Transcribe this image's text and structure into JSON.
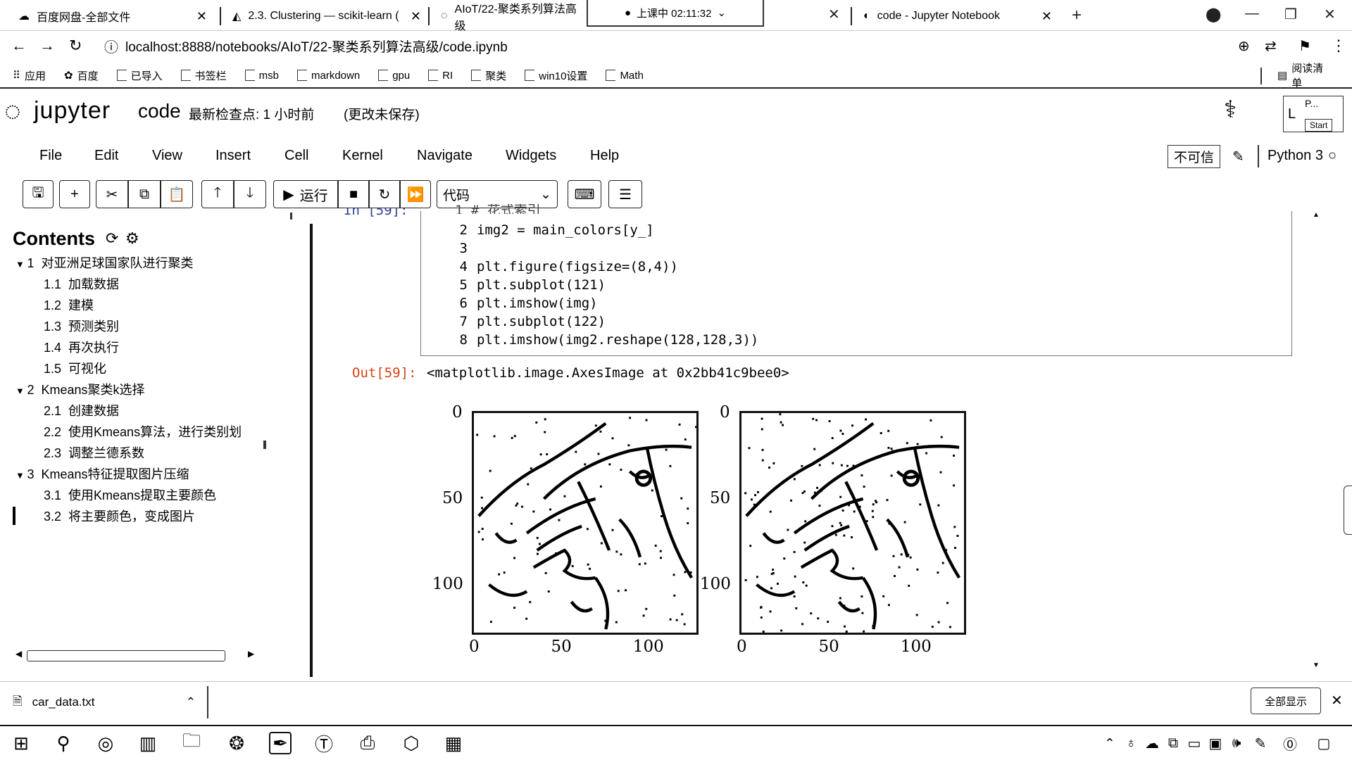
{
  "tabs": [
    {
      "title": "百度网盘-全部文件",
      "icon": "cloud-icon"
    },
    {
      "title": "2.3. Clustering — scikit-learn (",
      "icon": "sklearn-icon"
    },
    {
      "title": "AIoT/22-聚类系列算法高级",
      "icon": "loading-icon"
    },
    {
      "title": "code - Jupyter Notebook",
      "icon": "jupyter-icon"
    }
  ],
  "recording": {
    "label": "上课中 02:11:32"
  },
  "address": {
    "url": "localhost:8888/notebooks/AIoT/22-聚类系列算法高级/code.ipynb"
  },
  "bookmarks": [
    "应用",
    "百度",
    "已导入",
    "书签栏",
    "msb",
    "markdown",
    "gpu",
    "RI",
    "聚类",
    "win10设置",
    "Math"
  ],
  "reading_list": "阅读清单",
  "jupyter": {
    "logo": "jupyter",
    "notebook_name": "code",
    "checkpoint": "最新检查点: 1 小时前",
    "unsaved": "(更改未保存)",
    "menu": [
      "File",
      "Edit",
      "View",
      "Insert",
      "Cell",
      "Kernel",
      "Navigate",
      "Widgets",
      "Help"
    ],
    "trust": "不可信",
    "kernel": "Python 3",
    "run_label": "运行",
    "cell_type": "代码",
    "popup": {
      "line1": "P...",
      "start": "Start",
      "side": "L"
    }
  },
  "toc": {
    "title": "Contents",
    "items": [
      {
        "num": "1",
        "text": "对亚洲足球国家队进行聚类",
        "level": 1
      },
      {
        "num": "1.1",
        "text": "加载数据",
        "level": 2
      },
      {
        "num": "1.2",
        "text": "建模",
        "level": 2
      },
      {
        "num": "1.3",
        "text": "预测类别",
        "level": 2
      },
      {
        "num": "1.4",
        "text": "再次执行",
        "level": 2
      },
      {
        "num": "1.5",
        "text": "可视化",
        "level": 2
      },
      {
        "num": "2",
        "text": "Kmeans聚类k选择",
        "level": 1
      },
      {
        "num": "2.1",
        "text": "创建数据",
        "level": 2
      },
      {
        "num": "2.2",
        "text": "使用Kmeans算法，进行类别划",
        "level": 2
      },
      {
        "num": "2.3",
        "text": "调整兰德系数",
        "level": 2
      },
      {
        "num": "3",
        "text": "Kmeans特征提取图片压缩",
        "level": 1
      },
      {
        "num": "3.1",
        "text": "使用Kmeans提取主要颜色",
        "level": 2
      },
      {
        "num": "3.2",
        "text": "将主要颜色，变成图片",
        "level": 2
      }
    ]
  },
  "cell": {
    "in_prompt": "In [59]:",
    "lines": [
      {
        "n": "2",
        "code": "img2 = main_colors[y_]"
      },
      {
        "n": "3",
        "code": ""
      },
      {
        "n": "4",
        "code": "plt.figure(figsize=(8,4))"
      },
      {
        "n": "5",
        "code": "plt.subplot(121)"
      },
      {
        "n": "6",
        "code": "plt.imshow(img)"
      },
      {
        "n": "7",
        "code": "plt.subplot(122)"
      },
      {
        "n": "8",
        "code": "plt.imshow(img2.reshape(128,128,3))"
      }
    ],
    "out_prompt": "Out[59]:",
    "out_text": "<matplotlib.image.AxesImage at 0x2bb41c9bee0>"
  },
  "chart_data": [
    {
      "type": "image",
      "x_ticks": [
        "0",
        "50",
        "100"
      ],
      "y_ticks": [
        "0",
        "50",
        "100"
      ],
      "xlim": [
        0,
        128
      ],
      "ylim": [
        128,
        0
      ]
    },
    {
      "type": "image",
      "x_ticks": [
        "0",
        "50",
        "100"
      ],
      "y_ticks": [
        "0",
        "50",
        "100"
      ],
      "xlim": [
        0,
        128
      ],
      "ylim": [
        128,
        0
      ]
    }
  ],
  "download": {
    "file": "car_data.txt",
    "show_all": "全部显示"
  }
}
